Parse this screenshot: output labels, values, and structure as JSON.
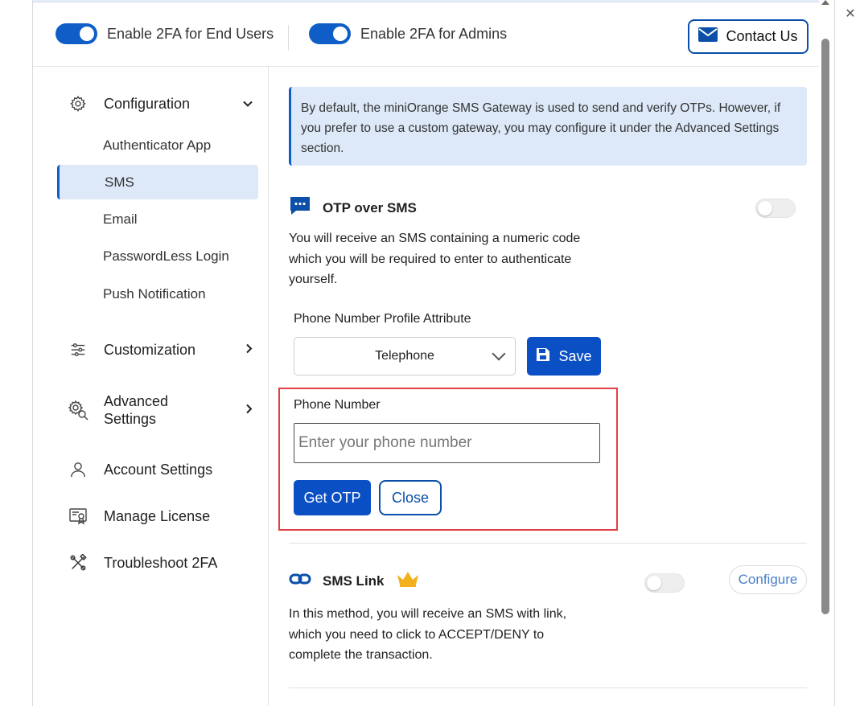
{
  "header": {
    "toggle_end_users_label": "Enable 2FA for End Users",
    "toggle_admins_label": "Enable 2FA for Admins",
    "contact_label": "Contact Us"
  },
  "sidebar": {
    "configuration": "Configuration",
    "sub_items": [
      "Authenticator App",
      "SMS",
      "Email",
      "PasswordLess Login",
      "Push Notification"
    ],
    "customization": "Customization",
    "advanced_line1": "Advanced",
    "advanced_line2": "Settings",
    "account_settings": "Account Settings",
    "manage_license": "Manage License",
    "troubleshoot": "Troubleshoot 2FA"
  },
  "main": {
    "info_text": "By default, the miniOrange SMS Gateway is used to send and verify OTPs. However, if you prefer to use a custom gateway, you may configure it under the Advanced Settings section.",
    "otp_title": "OTP over SMS",
    "otp_desc_1": "You will receive an SMS containing a numeric code",
    "otp_desc_2": "which you will be required to enter to authenticate",
    "otp_desc_3": "yourself.",
    "profile_attr_label": "Phone Number Profile Attribute",
    "profile_attr_value": "Telephone",
    "save_label": "Save",
    "phone_label": "Phone Number",
    "phone_placeholder": "Enter your phone number",
    "get_otp_label": "Get OTP",
    "close_label": "Close",
    "sms_link_title": "SMS Link",
    "configure_label": "Configure",
    "sms_link_desc_1": "In this method, you will receive an SMS with link,",
    "sms_link_desc_2": "which you need to click to ACCEPT/DENY to",
    "sms_link_desc_3": "complete the transaction."
  },
  "colors": {
    "accent": "#0f5ec7",
    "highlight_border": "#e04046",
    "info_bg": "#dde9f8",
    "crown": "#f2b01e"
  }
}
